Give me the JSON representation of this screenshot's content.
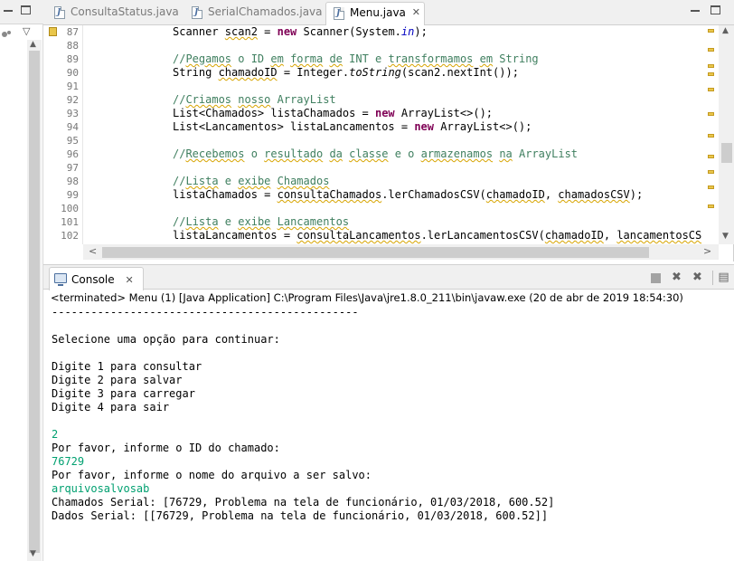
{
  "editor": {
    "tabs": [
      {
        "label": "ConsultaStatus.java",
        "active": false
      },
      {
        "label": "SerialChamados.java",
        "active": false
      },
      {
        "label": "Menu.java",
        "active": true
      }
    ],
    "lines": [
      {
        "n": "87"
      },
      {
        "n": "88"
      },
      {
        "n": "89"
      },
      {
        "n": "90"
      },
      {
        "n": "91"
      },
      {
        "n": "92"
      },
      {
        "n": "93"
      },
      {
        "n": "94"
      },
      {
        "n": "95"
      },
      {
        "n": "96"
      },
      {
        "n": "97"
      },
      {
        "n": "98"
      },
      {
        "n": "99"
      },
      {
        "n": "100"
      },
      {
        "n": "101"
      },
      {
        "n": "102"
      }
    ],
    "code": {
      "l87": {
        "a": "Scanner ",
        "b": "scan2",
        "c": " = ",
        "kw": "new",
        "d": " Scanner(System.",
        "e": "in",
        "f": ");"
      },
      "l89": {
        "a": "//",
        "b": "Pegamos",
        "c": " o ID ",
        "d": "em",
        "e": " ",
        "f": "forma",
        "g": " ",
        "h": "de",
        "i": " INT e ",
        "j": "transformamos",
        "k": " ",
        "l": "em",
        "m": " String"
      },
      "l90": {
        "a": "String ",
        "b": "chamadoID",
        "c": " = Integer.",
        "d": "toString",
        "e": "(scan2.nextInt());"
      },
      "l92": {
        "a": "//",
        "b": "Criamos",
        "c": " ",
        "d": "nosso",
        "e": " ArrayList"
      },
      "l93": {
        "a": "List<Chamados> listaChamados = ",
        "kw": "new",
        "b": " ArrayList<>();"
      },
      "l94": {
        "a": "List<Lancamentos> listaLancamentos = ",
        "kw": "new",
        "b": " ArrayList<>();"
      },
      "l96": {
        "a": "//",
        "b": "Recebemos",
        "c": " o ",
        "d": "resultado",
        "e": " ",
        "f": "da",
        "g": " ",
        "h": "classe",
        "i": " e o ",
        "j": "armazenamos",
        "k": " ",
        "l": "na",
        "m": " ArrayList"
      },
      "l98": {
        "a": "//",
        "b": "Lista",
        "c": " e ",
        "d": "exibe",
        "e": " ",
        "f": "Chamados"
      },
      "l99": {
        "a": "listaChamados = ",
        "b": "consultaChamados",
        "c": ".lerChamadosCSV(",
        "d": "chamadoID",
        "e": ", ",
        "f": "chamadosCSV",
        "g": ");"
      },
      "l101": {
        "a": "//",
        "b": "Lista",
        "c": " e ",
        "d": "exibe",
        "e": " ",
        "f": "Lancamentos"
      },
      "l102": {
        "a": "listaLancamentos = ",
        "b": "consultaLancamentos",
        "c": ".lerLancamentosCSV(",
        "d": "chamadoID",
        "e": ", ",
        "f": "lancamentosCSV",
        "g": ");"
      }
    }
  },
  "console": {
    "tab_label": "Console",
    "tab_close": "✕",
    "status": "<terminated> Menu (1) [Java Application] C:\\Program Files\\Java\\jre1.8.0_211\\bin\\javaw.exe (20 de abr de 2019 18:54:30)",
    "output": [
      {
        "text": "-----------------------------------------------",
        "input": false
      },
      {
        "text": "",
        "input": false
      },
      {
        "text": "Selecione uma opção para continuar:",
        "input": false
      },
      {
        "text": "",
        "input": false
      },
      {
        "text": "Digite 1 para consultar",
        "input": false
      },
      {
        "text": "Digite 2 para salvar",
        "input": false
      },
      {
        "text": "Digite 3 para carregar",
        "input": false
      },
      {
        "text": "Digite 4 para sair",
        "input": false
      },
      {
        "text": "",
        "input": false
      },
      {
        "text": "2",
        "input": true
      },
      {
        "text": "Por favor, informe o ID do chamado:",
        "input": false
      },
      {
        "text": "76729",
        "input": true
      },
      {
        "text": "Por favor, informe o nome do arquivo a ser salvo:",
        "input": false
      },
      {
        "text": "arquivosalvosab",
        "input": true
      },
      {
        "text": "Chamados Serial: [76729, Problema na tela de funcionário, 01/03/2018, 600.52]",
        "input": false
      },
      {
        "text": "Dados Serial: [[76729, Problema na tela de funcionário, 01/03/2018, 600.52]]",
        "input": false
      }
    ]
  },
  "colors": {
    "keyword": "#7f0055",
    "comment": "#3f7f5f",
    "field": "#0000c0",
    "console_input": "#00a070"
  },
  "icons": {
    "tab_file": "java-file-icon",
    "console": "console-monitor-icon",
    "marker": "warning-marker-icon"
  }
}
